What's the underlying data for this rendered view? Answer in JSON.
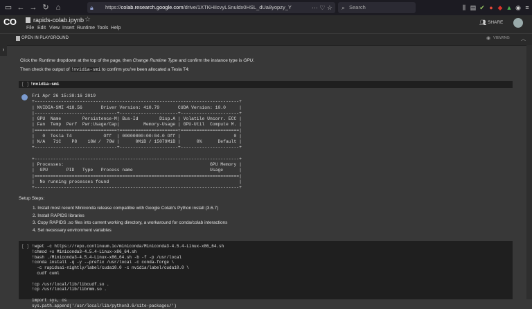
{
  "browser": {
    "nav_icons": [
      "←",
      "→",
      "↻",
      "⌂"
    ],
    "url_host": "colab.research.google.com",
    "url_prefix": "https://",
    "url_suffix": "/drive/1XTKHiIcvyLSnuldx0HSL_dUa8yopzy_Y",
    "url_action_icons": "⋯ ♡ ☆",
    "search_placeholder": "Search",
    "extensions": [
      {
        "glyph": "⫼",
        "color": "#cccccc"
      },
      {
        "glyph": "▤",
        "color": "#cccccc"
      },
      {
        "glyph": "✔",
        "color": "#9ccc65"
      },
      {
        "glyph": "●",
        "color": "#e04a3a"
      },
      {
        "glyph": "◆",
        "color": "#d9342b"
      },
      {
        "glyph": "▲",
        "color": "#4caf50"
      },
      {
        "glyph": "◉",
        "color": "#cccccc"
      },
      {
        "glyph": "≡",
        "color": "#cccccc"
      }
    ]
  },
  "colab": {
    "logo": "CO",
    "notebook_title": "rapids-colab.ipynb",
    "menu": [
      "File",
      "Edit",
      "View",
      "Insert",
      "Runtime",
      "Tools",
      "Help"
    ],
    "share_label": "SHARE",
    "open_in_playground": "OPEN IN PLAYGROUND",
    "viewing_label": "VIEWING"
  },
  "content": {
    "intro_1a": "Click the ",
    "intro_1b": "Runtime",
    "intro_1c": " dropdown at the top of the page, then ",
    "intro_1d": "Change Runtime Type",
    "intro_1e": " and confirm the instance type is ",
    "intro_1f": "GPU",
    "intro_1g": ".",
    "intro_2a": "Then check the output of ",
    "intro_2b": "!nvidia-smi",
    "intro_2c": " to confirm you've been allocated a Tesla T4:",
    "cell1_run": "[ ]",
    "cell1_code": "!nvidia-smi",
    "nvidia_output": "Fri Apr 26 15:38:16 2019\n+-----------------------------------------------------------------------------+\n| NVIDIA-SMI 418.56       Driver Version: 410.79       CUDA Version: 10.0     |\n|-------------------------------+----------------------+----------------------+\n| GPU  Name        Persistence-M| Bus-Id        Disp.A | Volatile Uncorr. ECC |\n| Fan  Temp  Perf  Pwr:Usage/Cap|         Memory-Usage | GPU-Util  Compute M. |\n|===============================+======================+======================|\n|   0  Tesla T4            Off  | 00000000:00:04.0 Off |                    0 |\n| N/A   71C    P8    18W /  70W |      0MiB / 15079MiB |      0%      Default |\n+-------------------------------+----------------------+----------------------+\n\n+-----------------------------------------------------------------------------+\n| Processes:                                                       GPU Memory |\n|  GPU       PID   Type   Process name                             Usage      |\n|=============================================================================|\n|  No running processes found                                                 |\n+-----------------------------------------------------------------------------+",
    "steps_title": "Setup Steps:",
    "steps": [
      "1. Install most recent Miniconda release compatible with Google Colab's Python install (3.6.7)",
      "2. Install RAPIDS libraries",
      "3. Copy RAPIDS .so files into current working directory, a workaround for conda/colab interactions",
      "4. Set necessary environment variables"
    ],
    "cell2_run": "[ ]",
    "cell2_lines": [
      "!wget -c https://repo.continuum.io/miniconda/Miniconda3-4.5.4-Linux-x86_64.sh",
      "!chmod +x Miniconda3-4.5.4-Linux-x86_64.sh",
      "!bash ./Miniconda3-4.5.4-Linux-x86_64.sh -b -f -p /usr/local",
      "!conda install -q -y --prefix /usr/local -c conda-forge \\",
      "  -c rapidsai-nightly/label/cuda10.0 -c nvidia/label/cuda10.0 \\",
      "  cudf cuml",
      "",
      "!cp /usr/local/lib/libcudf.so .",
      "!cp /usr/local/lib/librmm.so .",
      "",
      "import sys, os",
      "sys.path.append('/usr/local/lib/python3.6/site-packages/')"
    ]
  }
}
